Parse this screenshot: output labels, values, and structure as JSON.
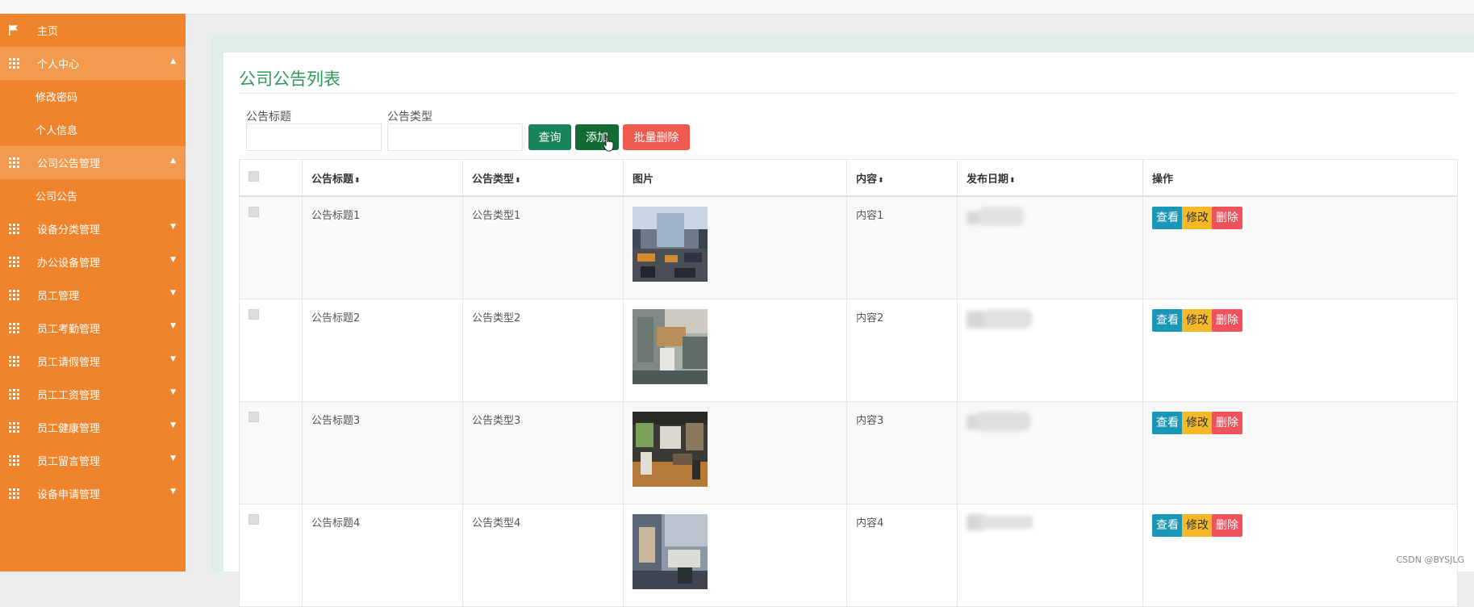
{
  "sidebar": {
    "items": [
      {
        "label": "主页",
        "icon": "flag-icon",
        "level": "top",
        "expanded": false,
        "caret": ""
      },
      {
        "label": "个人中心",
        "icon": "grid-icon",
        "level": "top",
        "expanded": true,
        "caret": "▲"
      },
      {
        "label": "修改密码",
        "level": "sub"
      },
      {
        "label": "个人信息",
        "level": "sub"
      },
      {
        "label": "公司公告管理",
        "icon": "grid-icon",
        "level": "top",
        "expanded": true,
        "caret": "▲"
      },
      {
        "label": "公司公告",
        "level": "sub"
      },
      {
        "label": "设备分类管理",
        "icon": "grid-icon",
        "level": "top",
        "expanded": false,
        "caret": "▼"
      },
      {
        "label": "办公设备管理",
        "icon": "grid-icon",
        "level": "top",
        "expanded": false,
        "caret": "▼"
      },
      {
        "label": "员工管理",
        "icon": "grid-icon",
        "level": "top",
        "expanded": false,
        "caret": "▼"
      },
      {
        "label": "员工考勤管理",
        "icon": "grid-icon",
        "level": "top",
        "expanded": false,
        "caret": "▼"
      },
      {
        "label": "员工请假管理",
        "icon": "grid-icon",
        "level": "top",
        "expanded": false,
        "caret": "▼"
      },
      {
        "label": "员工工资管理",
        "icon": "grid-icon",
        "level": "top",
        "expanded": false,
        "caret": "▼"
      },
      {
        "label": "员工健康管理",
        "icon": "grid-icon",
        "level": "top",
        "expanded": false,
        "caret": "▼"
      },
      {
        "label": "员工留言管理",
        "icon": "grid-icon",
        "level": "top",
        "expanded": false,
        "caret": "▼"
      },
      {
        "label": "设备申请管理",
        "icon": "grid-icon",
        "level": "top",
        "expanded": false,
        "caret": "▼"
      }
    ]
  },
  "main": {
    "title": "公司公告列表",
    "search": {
      "title_label": "公告标题",
      "title_value": "",
      "type_label": "公告类型",
      "type_value": "",
      "query_button": "查询",
      "add_button": "添加",
      "batch_delete_button": "批量删除"
    },
    "table": {
      "headers": {
        "title": "公告标题",
        "type": "公告类型",
        "image": "图片",
        "content": "内容",
        "date": "发布日期",
        "actions": "操作"
      },
      "sort_icon": "⬍",
      "rows": [
        {
          "title": "公告标题1",
          "type": "公告类型1",
          "content": "内容1",
          "image": "office-photo-1"
        },
        {
          "title": "公告标题2",
          "type": "公告类型2",
          "content": "内容2",
          "image": "office-photo-2"
        },
        {
          "title": "公告标题3",
          "type": "公告类型3",
          "content": "内容3",
          "image": "office-photo-3"
        },
        {
          "title": "公告标题4",
          "type": "公告类型4",
          "content": "内容4",
          "image": "office-photo-4"
        }
      ],
      "actions": {
        "view": "查看",
        "edit": "修改",
        "delete": "删除"
      }
    }
  },
  "watermark": "CSDN @BYSJLG",
  "colors": {
    "sidebar": "#f0842d",
    "sidebar_active": "#f39a4e",
    "title": "#2e9a5b",
    "query_btn": "#17845a",
    "add_btn": "#126b33",
    "batch_btn": "#ef5a4f",
    "view_btn": "#1a96b6",
    "edit_btn": "#f5b928",
    "delete_btn": "#f0525b"
  }
}
